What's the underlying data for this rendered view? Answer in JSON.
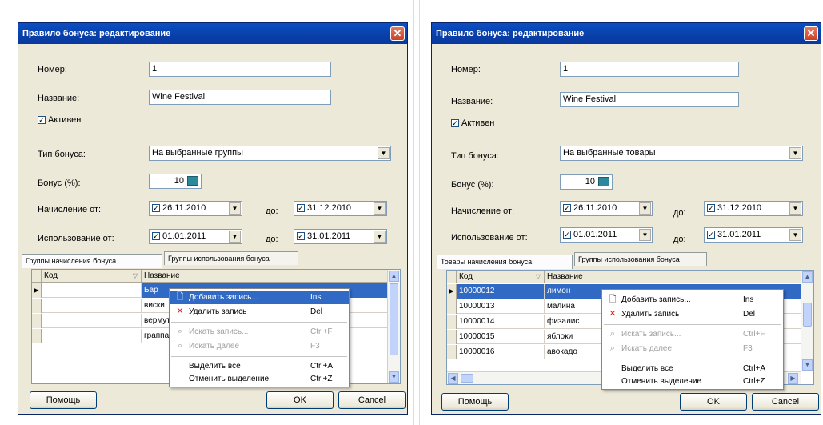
{
  "left": {
    "title": "Правило бонуса: редактирование",
    "close_glyph": "✕",
    "number_label": "Номер:",
    "number_value": "1",
    "name_label": "Название:",
    "name_value": "Wine Festival",
    "active_label": "Активен",
    "type_label": "Тип бонуса:",
    "type_value": "На выбранные группы",
    "bonus_label": "Бонус (%):",
    "bonus_value": "10",
    "accrual_label": "Начисление от:",
    "accrual_from": "26.11.2010",
    "to_label": "до:",
    "accrual_to": "31.12.2010",
    "usage_label": "Использование от:",
    "usage_from": "01.01.2011",
    "usage_to": "31.01.2011",
    "tab1": "Группы начисления бонуса",
    "tab2": "Группы использования бонуса",
    "col_code": "Код",
    "col_name": "Название",
    "rows": [
      {
        "code": "",
        "name": "Бар"
      },
      {
        "code": "",
        "name": "виски"
      },
      {
        "code": "",
        "name": "вермут"
      },
      {
        "code": "",
        "name": "граппа"
      }
    ],
    "help_btn": "Помощь",
    "ok_btn": "OK",
    "cancel_btn": "Cancel"
  },
  "right": {
    "title": "Правило бонуса: редактирование",
    "close_glyph": "✕",
    "number_label": "Номер:",
    "number_value": "1",
    "name_label": "Название:",
    "name_value": "Wine Festival",
    "active_label": "Активен",
    "type_label": "Тип бонуса:",
    "type_value": "На выбранные товары",
    "bonus_label": "Бонус (%):",
    "bonus_value": "10",
    "accrual_label": "Начисление от:",
    "accrual_from": "26.11.2010",
    "to_label": "до:",
    "accrual_to": "31.12.2010",
    "usage_label": "Использование от:",
    "usage_from": "01.01.2011",
    "usage_to": "31.01.2011",
    "tab1": "Товары начисления бонуса",
    "tab2": "Группы использования бонуса",
    "col_code": "Код",
    "col_name": "Название",
    "rows": [
      {
        "code": "10000012",
        "name": "лимон"
      },
      {
        "code": "10000013",
        "name": "малина"
      },
      {
        "code": "10000014",
        "name": "физалис"
      },
      {
        "code": "10000015",
        "name": "яблоки"
      },
      {
        "code": "10000016",
        "name": "авокадо"
      }
    ],
    "help_btn": "Помощь",
    "ok_btn": "OK",
    "cancel_btn": "Cancel"
  },
  "menu": {
    "add": {
      "label": "Добавить запись...",
      "key": "Ins"
    },
    "delete": {
      "label": "Удалить запись",
      "key": "Del"
    },
    "find": {
      "label": "Искать запись...",
      "key": "Ctrl+F"
    },
    "find_next": {
      "label": "Искать далее",
      "key": "F3"
    },
    "select_all": {
      "label": "Выделить все",
      "key": "Ctrl+A"
    },
    "deselect": {
      "label": "Отменить выделение",
      "key": "Ctrl+Z"
    }
  },
  "colors": {
    "title_bar": "#0a3fa8",
    "selection": "#316ac5",
    "dialog_bg": "#ece9d8"
  }
}
